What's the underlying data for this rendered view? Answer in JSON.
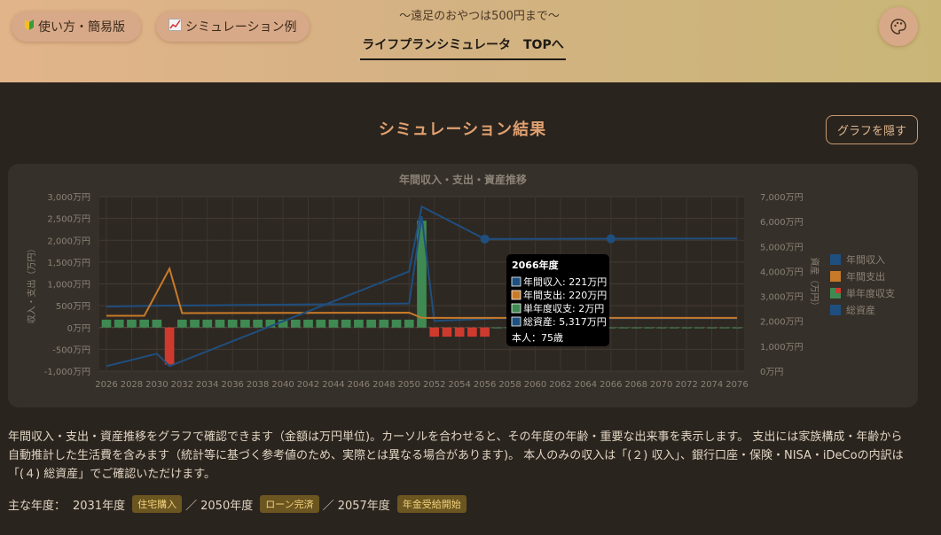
{
  "header": {
    "usage_label": "使い方・簡易版",
    "usage_icon": "beginner-mark-icon",
    "sim_label": "シミュレーション例",
    "sim_icon": "chart-up-icon",
    "tagline": "〜遠足のおやつは500円まで〜",
    "nav_title": "ライフプランシミュレータ　TOPへ",
    "palette_icon": "palette-icon"
  },
  "result": {
    "title": "シミュレーション結果",
    "hide_button": "グラフを隠す"
  },
  "chart_data": {
    "type": "bar",
    "title": "年間収入・支出・資産推移",
    "ylabel": "収入・支出（万円）",
    "y2label": "資産（万円）",
    "ylim": [
      -1000,
      3000
    ],
    "y2lim": [
      0,
      7000
    ],
    "y_ticks": [
      "3,000万円",
      "2,500万円",
      "2,000万円",
      "1,500万円",
      "1,000万円",
      "500万円",
      "0万円",
      "-500万円",
      "-1,000万円"
    ],
    "y2_ticks": [
      "7,000万円",
      "6,000万円",
      "5,000万円",
      "4,000万円",
      "3,000万円",
      "2,000万円",
      "1,000万円",
      "0万円"
    ],
    "x_ticks": [
      "2026",
      "2028",
      "2030",
      "2032",
      "2034",
      "2036",
      "2038",
      "2040",
      "2042",
      "2044",
      "2046",
      "2048",
      "2050",
      "2052",
      "2054",
      "2056",
      "2058",
      "2060",
      "2062",
      "2064",
      "2066",
      "2068",
      "2070",
      "2072",
      "2074",
      "2076"
    ],
    "x_start": 2026,
    "x_end": 2076,
    "grid": true,
    "legend_position": "right",
    "series": [
      {
        "name": "年間収入",
        "type": "line",
        "color": "#1f4f7f",
        "points": [
          [
            2026,
            480
          ],
          [
            2030,
            500
          ],
          [
            2050,
            550
          ],
          [
            2051,
            2550
          ],
          [
            2052,
            150
          ],
          [
            2057,
            210
          ],
          [
            2076,
            210
          ]
        ]
      },
      {
        "name": "年間支出",
        "type": "line",
        "color": "#c87a28",
        "points": [
          [
            2026,
            270
          ],
          [
            2029,
            270
          ],
          [
            2031,
            1350
          ],
          [
            2032,
            330
          ],
          [
            2050,
            340
          ],
          [
            2051,
            220
          ],
          [
            2076,
            220
          ]
        ]
      },
      {
        "name": "単年度収支",
        "type": "bar",
        "color_pos": "#3f8a52",
        "color_neg": "#cf3a2e",
        "values": [
          [
            2026,
            180
          ],
          [
            2027,
            180
          ],
          [
            2028,
            180
          ],
          [
            2029,
            180
          ],
          [
            2030,
            180
          ],
          [
            2031,
            -850
          ],
          [
            2032,
            180
          ],
          [
            2033,
            180
          ],
          [
            2034,
            180
          ],
          [
            2035,
            180
          ],
          [
            2036,
            180
          ],
          [
            2037,
            180
          ],
          [
            2038,
            180
          ],
          [
            2039,
            180
          ],
          [
            2040,
            180
          ],
          [
            2041,
            180
          ],
          [
            2042,
            180
          ],
          [
            2043,
            180
          ],
          [
            2044,
            180
          ],
          [
            2045,
            180
          ],
          [
            2046,
            180
          ],
          [
            2047,
            180
          ],
          [
            2048,
            180
          ],
          [
            2049,
            180
          ],
          [
            2050,
            180
          ],
          [
            2051,
            2450
          ],
          [
            2052,
            -210
          ],
          [
            2053,
            -210
          ],
          [
            2054,
            -210
          ],
          [
            2055,
            -210
          ],
          [
            2056,
            -210
          ],
          [
            2057,
            2
          ],
          [
            2058,
            2
          ],
          [
            2059,
            2
          ],
          [
            2060,
            2
          ],
          [
            2061,
            2
          ],
          [
            2062,
            2
          ],
          [
            2063,
            2
          ],
          [
            2064,
            2
          ],
          [
            2065,
            2
          ],
          [
            2066,
            2
          ],
          [
            2067,
            2
          ],
          [
            2068,
            2
          ],
          [
            2069,
            2
          ],
          [
            2070,
            2
          ],
          [
            2071,
            2
          ],
          [
            2072,
            2
          ],
          [
            2073,
            2
          ],
          [
            2074,
            2
          ],
          [
            2075,
            2
          ],
          [
            2076,
            2
          ]
        ]
      },
      {
        "name": "総資産",
        "type": "line",
        "axis": "right",
        "color": "#1f4f7f",
        "points": [
          [
            2026,
            200
          ],
          [
            2030,
            700
          ],
          [
            2031,
            200
          ],
          [
            2050,
            4000
          ],
          [
            2051,
            6600
          ],
          [
            2056,
            5300
          ],
          [
            2076,
            5320
          ]
        ],
        "markers": [
          2056,
          2066
        ]
      }
    ]
  },
  "tooltip": {
    "title": "2066年度",
    "rows": [
      {
        "label": "年間収入: 221万円",
        "color": "#1f4f7f"
      },
      {
        "label": "年間支出: 220万円",
        "color": "#c87a28"
      },
      {
        "label": "単年度収支: 2万円",
        "color": "#3f8a52"
      },
      {
        "label": "総資産: 5,317万円",
        "color": "#1f4f7f"
      }
    ],
    "footer": "本人：75歳"
  },
  "description": "年間収入・支出・資産推移をグラフで確認できます（金額は万円単位)。カーソルを合わせると、その年度の年齢・重要な出来事を表示します。 支出には家族構成・年齢から自動推計した生活費を含みます（統計等に基づく参考値のため、実際とは異なる場合があります)。 本人のみの収入は「(２) 収入」、銀行口座・保険・NISA・iDeCoの内訳は「(４) 総資産」でご確認いただけます。",
  "key_years": {
    "label": "主な年度：",
    "events": [
      {
        "year": "2031年度",
        "badge": "住宅購入"
      },
      {
        "year": "2050年度",
        "badge": "ローン完済"
      },
      {
        "year": "2057年度",
        "badge": "年金受給開始"
      }
    ],
    "separator": "／"
  }
}
